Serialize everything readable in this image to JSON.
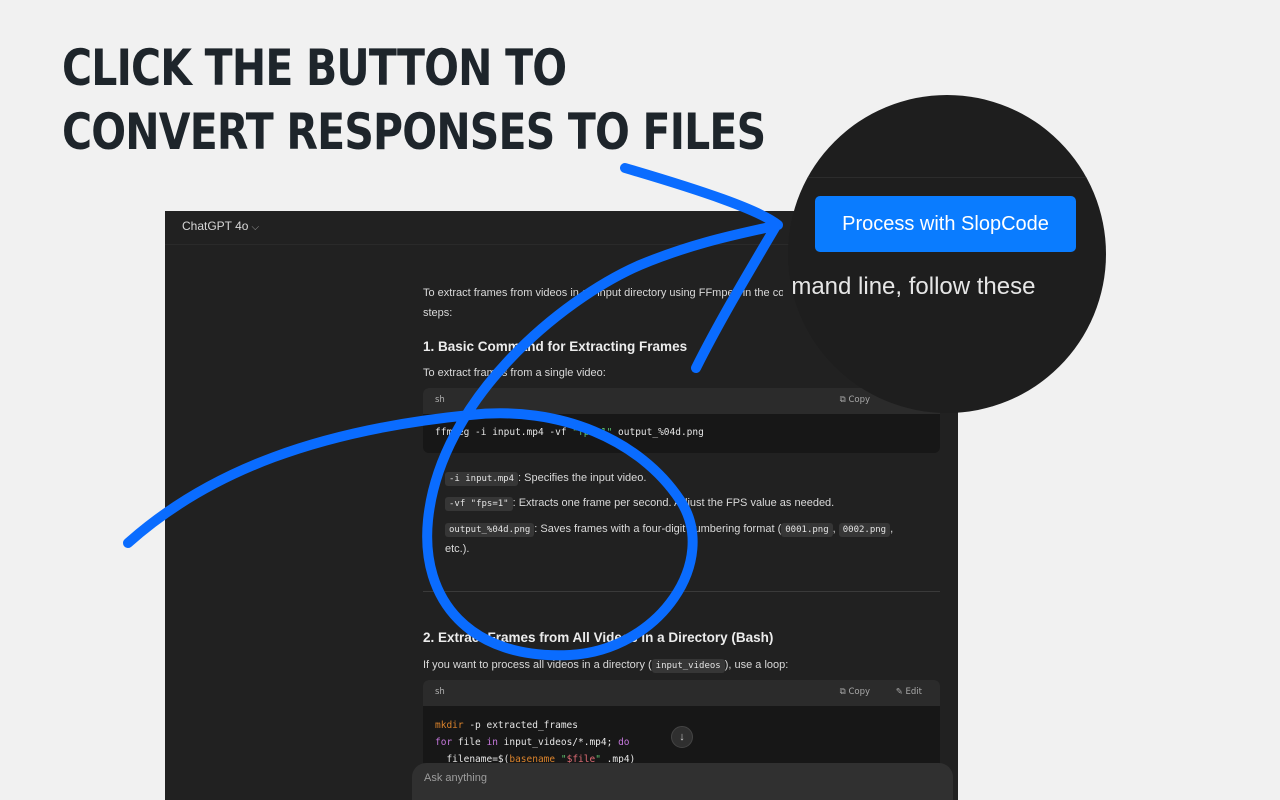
{
  "headline": {
    "line1": "CLICK THE BUTTON TO",
    "line2": "CONVERT RESPONSES TO FILES"
  },
  "topbar": {
    "model": "ChatGPT 4o",
    "chevron": "⌵"
  },
  "response": {
    "intro_line1": "To extract frames from videos in an input directory using FFmpeg in the command line, follow these",
    "intro_line2": "steps:",
    "section1_title": "1. Basic Command for Extracting Frames",
    "section1_text": "To extract frames from a single video:",
    "code1": {
      "lang": "sh",
      "copy_label": "Copy",
      "line_prefix": "ffmpeg -i input.mp4 -vf ",
      "line_string": "\"fps=1\"",
      "line_suffix": " output_%04d.png"
    },
    "bullets": [
      {
        "code": "-i input.mp4",
        "text": ": Specifies the input video."
      },
      {
        "code": "-vf \"fps=1\"",
        "text": ": Extracts one frame per second. Adjust the FPS value as needed."
      },
      {
        "code": "output_%04d.png",
        "text": ": Saves frames with a four-digit numbering format (",
        "code2": "0001.png",
        "sep": ", ",
        "code3": "0002.png",
        "tail": ",",
        "line2": "etc.)."
      }
    ],
    "section2_title": "2. Extract Frames from All Videos in a Directory (Bash)",
    "section2_text_pre": "If you want to process all videos in a directory (",
    "section2_code": "input_videos",
    "section2_text_post": "), use a loop:",
    "code2": {
      "lang": "sh",
      "copy_label": "Copy",
      "edit_label": "Edit",
      "l1_kw": "mkdir",
      "l1_rest": " -p extracted_frames",
      "l2_kw": "for",
      "l2_a": " file ",
      "l2_in": "in",
      "l2_b": " input_videos/*.mp4; ",
      "l2_do": "do",
      "l3_a": "  filename=$(",
      "l3_kw": "basename",
      "l3_sp": " ",
      "l3_str_open": "\"",
      "l3_var": "$file",
      "l3_str_close": "\"",
      "l3_b": " .mp4)"
    }
  },
  "composer": {
    "placeholder": "Ask anything"
  },
  "zoom": {
    "button_label": "Process with SlopCode",
    "text": "To extract frames from videos in an input directory using FFmpeg in the command line, follow these"
  },
  "icons": {
    "copy": "copy-icon",
    "edit": "edit-icon",
    "scroll": "arrow-down-icon"
  },
  "colors": {
    "accent": "#0a7cff",
    "background": "#f1f1f1",
    "window": "#212121"
  }
}
